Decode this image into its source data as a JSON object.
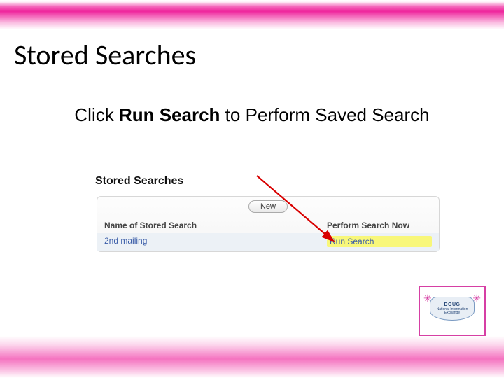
{
  "slide": {
    "title": "Stored Searches",
    "instruction_pre": "Click ",
    "instruction_bold": "Run Search",
    "instruction_post": " to Perform Saved Search"
  },
  "app": {
    "section_title": "Stored Searches",
    "new_button": "New",
    "col_name": "Name of Stored Search",
    "col_action": "Perform Search Now",
    "row": {
      "name": "2nd mailing",
      "action": "Run Search"
    }
  },
  "logo": {
    "line1": "DOUG",
    "line2": "National Information Exchange"
  },
  "colors": {
    "brand_pink": "#ec008c",
    "link_blue": "#3a5da8",
    "highlight": "#f8f77a"
  }
}
